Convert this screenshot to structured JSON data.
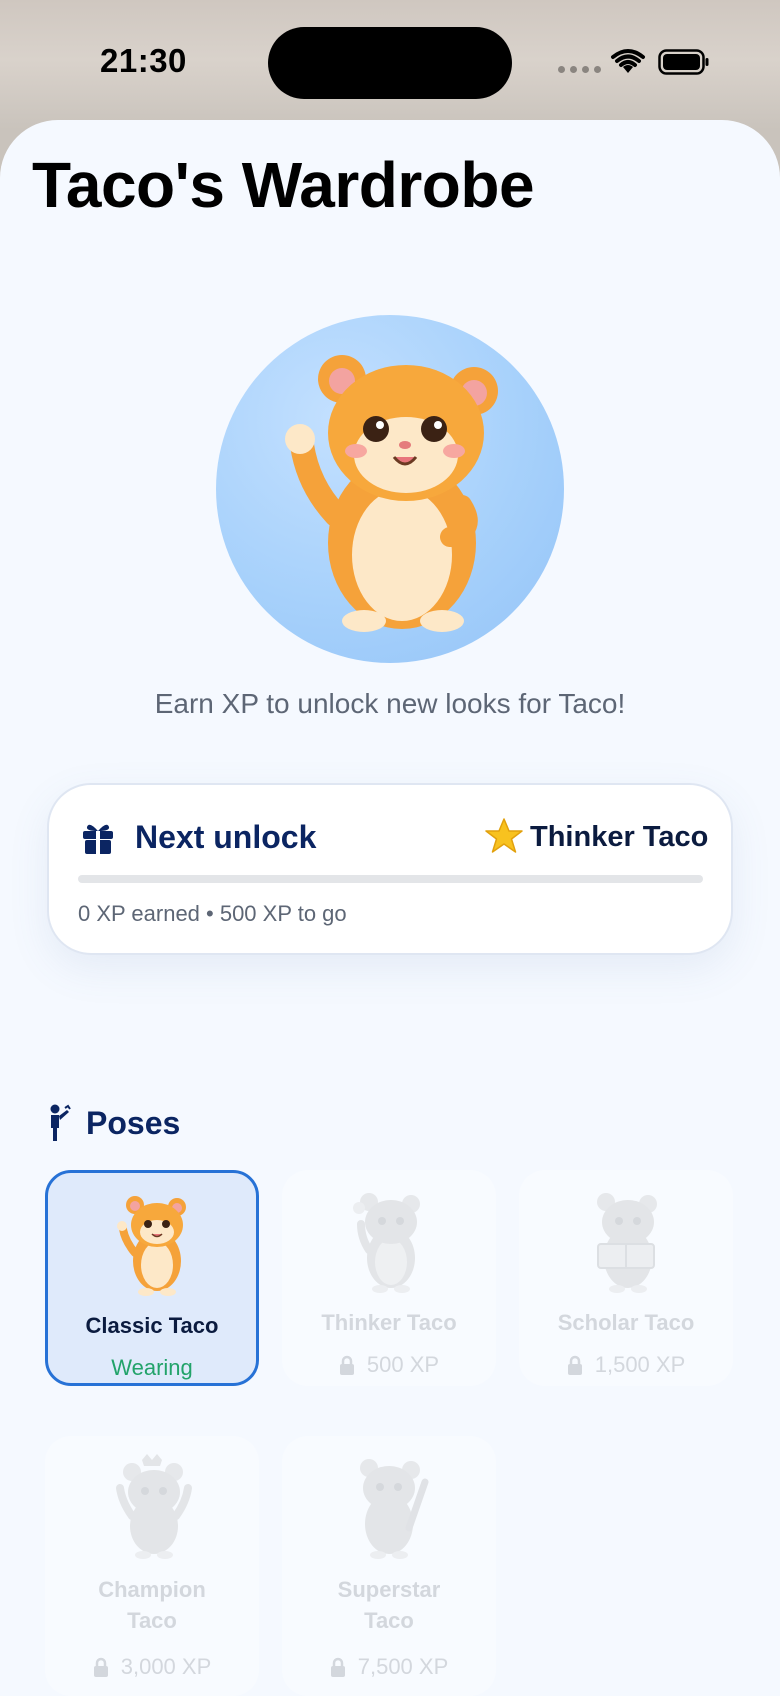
{
  "status_bar": {
    "time": "21:30"
  },
  "page": {
    "title": "Taco's Wardrobe",
    "subtitle": "Earn XP to unlock new looks for Taco!"
  },
  "next_unlock": {
    "title": "Next unlock",
    "target": "Thinker Taco",
    "progress": 0,
    "status": "0 XP earned • 500 XP to go"
  },
  "poses_section": {
    "title": "Poses"
  },
  "poses": [
    {
      "name": "Classic Taco",
      "status": "Wearing",
      "locked": false,
      "selected": true,
      "art": "hamster-waving-icon"
    },
    {
      "name": "Thinker Taco",
      "status": "500 XP",
      "locked": true,
      "selected": false,
      "art": "hamster-thinking-icon"
    },
    {
      "name": "Scholar Taco",
      "status": "1,500 XP",
      "locked": true,
      "selected": false,
      "art": "hamster-reading-icon"
    },
    {
      "name": "Champion Taco",
      "status": "3,000 XP",
      "locked": true,
      "selected": false,
      "art": "hamster-crown-icon"
    },
    {
      "name": "Superstar Taco",
      "status": "7,500 XP",
      "locked": true,
      "selected": false,
      "art": "hamster-star-icon"
    }
  ],
  "colors": {
    "accent": "#2772d6",
    "wearing": "#22a36a",
    "title_navy": "#0b2562",
    "avatar_bg": "#a7d1fb"
  }
}
